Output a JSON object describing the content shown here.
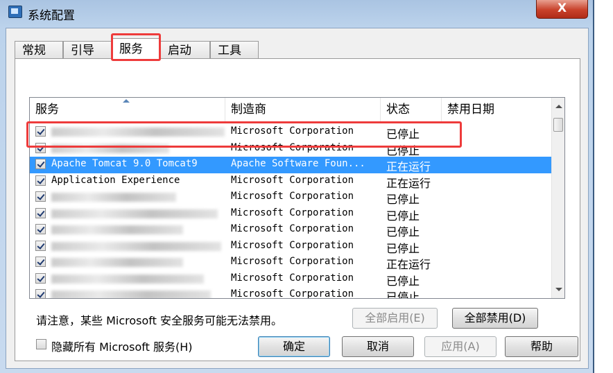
{
  "window": {
    "title": "系统配置",
    "close_label": "X"
  },
  "tabs": [
    "常规",
    "引导",
    "服务",
    "启动",
    "工具"
  ],
  "columns": [
    "服务",
    "制造商",
    "状态",
    "禁用日期"
  ],
  "services": [
    {
      "name": "",
      "vendor": "Microsoft Corporation",
      "status": "已停止",
      "checked": true,
      "selected": false
    },
    {
      "name": "",
      "vendor": "Microsoft Corporation",
      "status": "已停止",
      "checked": true,
      "selected": false
    },
    {
      "name": "Apache Tomcat 9.0 Tomcat9",
      "vendor": "Apache Software Foun...",
      "status": "正在运行",
      "checked": true,
      "selected": true
    },
    {
      "name": "Application Experience",
      "vendor": "Microsoft Corporation",
      "status": "正在运行",
      "checked": true,
      "selected": false
    },
    {
      "name": "",
      "vendor": "Microsoft Corporation",
      "status": "已停止",
      "checked": true,
      "selected": false
    },
    {
      "name": "",
      "vendor": "Microsoft Corporation",
      "status": "已停止",
      "checked": true,
      "selected": false
    },
    {
      "name": "",
      "vendor": "Microsoft Corporation",
      "status": "已停止",
      "checked": true,
      "selected": false
    },
    {
      "name": "",
      "vendor": "Microsoft Corporation",
      "status": "已停止",
      "checked": true,
      "selected": false
    },
    {
      "name": "",
      "vendor": "Microsoft Corporation",
      "status": "正在运行",
      "checked": true,
      "selected": false
    },
    {
      "name": "",
      "vendor": "Microsoft Corporation",
      "status": "已停止",
      "checked": true,
      "selected": false
    },
    {
      "name": "",
      "vendor": "Microsoft Corporation",
      "status": "已停止",
      "checked": true,
      "selected": false
    }
  ],
  "note": "请注意，某些 Microsoft 安全服务可能无法禁用。",
  "enable_all": "全部启用(E)",
  "disable_all": "全部禁用(D)",
  "hide_ms": {
    "label": "隐藏所有 Microsoft 服务(H)",
    "checked": false
  },
  "buttons": {
    "ok": "确定",
    "cancel": "取消",
    "apply": "应用(A)",
    "help": "帮助"
  },
  "colors": {
    "selection": "#3399ff",
    "annotation": "#ee3b3b"
  }
}
